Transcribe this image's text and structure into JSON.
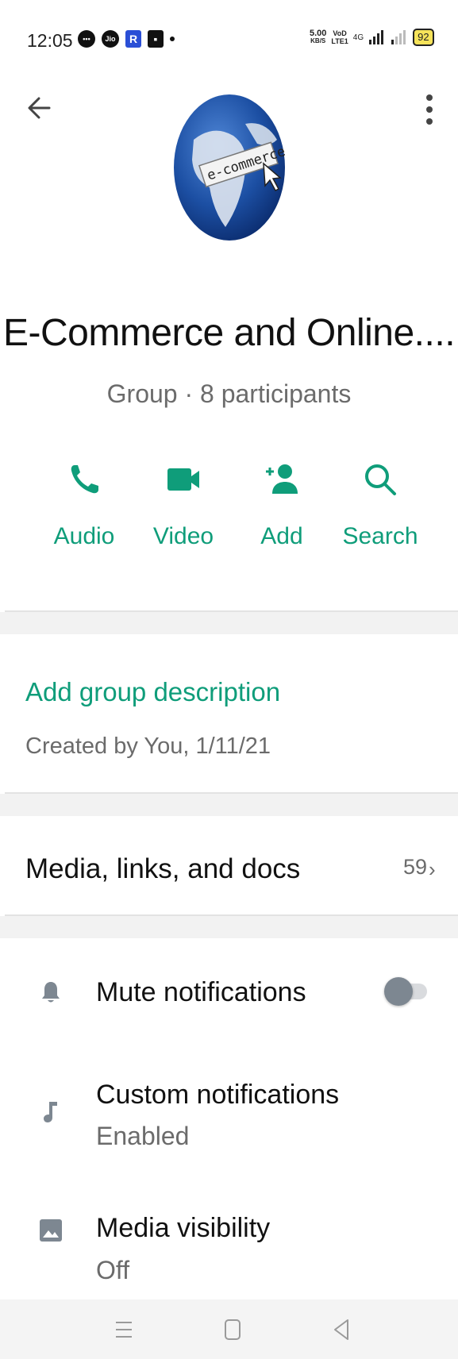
{
  "status_bar": {
    "time": "12:05",
    "speed_value": "5.00",
    "speed_unit": "KB/S",
    "volte_top": "VoD",
    "volte_bottom": "LTE1",
    "network": "4G",
    "battery": "92"
  },
  "header": {
    "avatar_text": "e-commerce",
    "title": "E-Commerce and Online....",
    "subtitle": "Group · 8 participants"
  },
  "actions": [
    {
      "label": "Audio",
      "icon": "phone-icon"
    },
    {
      "label": "Video",
      "icon": "video-camera-icon"
    },
    {
      "label": "Add",
      "icon": "add-person-icon"
    },
    {
      "label": "Search",
      "icon": "search-icon"
    }
  ],
  "description": {
    "add_link": "Add group description",
    "created": "Created by You, 1/11/21"
  },
  "media": {
    "label": "Media, links, and docs",
    "count": "59"
  },
  "settings": [
    {
      "label": "Mute notifications",
      "sub": "",
      "icon": "bell-icon",
      "toggle_on": false
    },
    {
      "label": "Custom notifications",
      "sub": "Enabled",
      "icon": "music-note-icon"
    },
    {
      "label": "Media visibility",
      "sub": "Off",
      "icon": "image-icon"
    }
  ],
  "colors": {
    "accent": "#0f9d7a",
    "muted_text": "#6b6b6b"
  }
}
